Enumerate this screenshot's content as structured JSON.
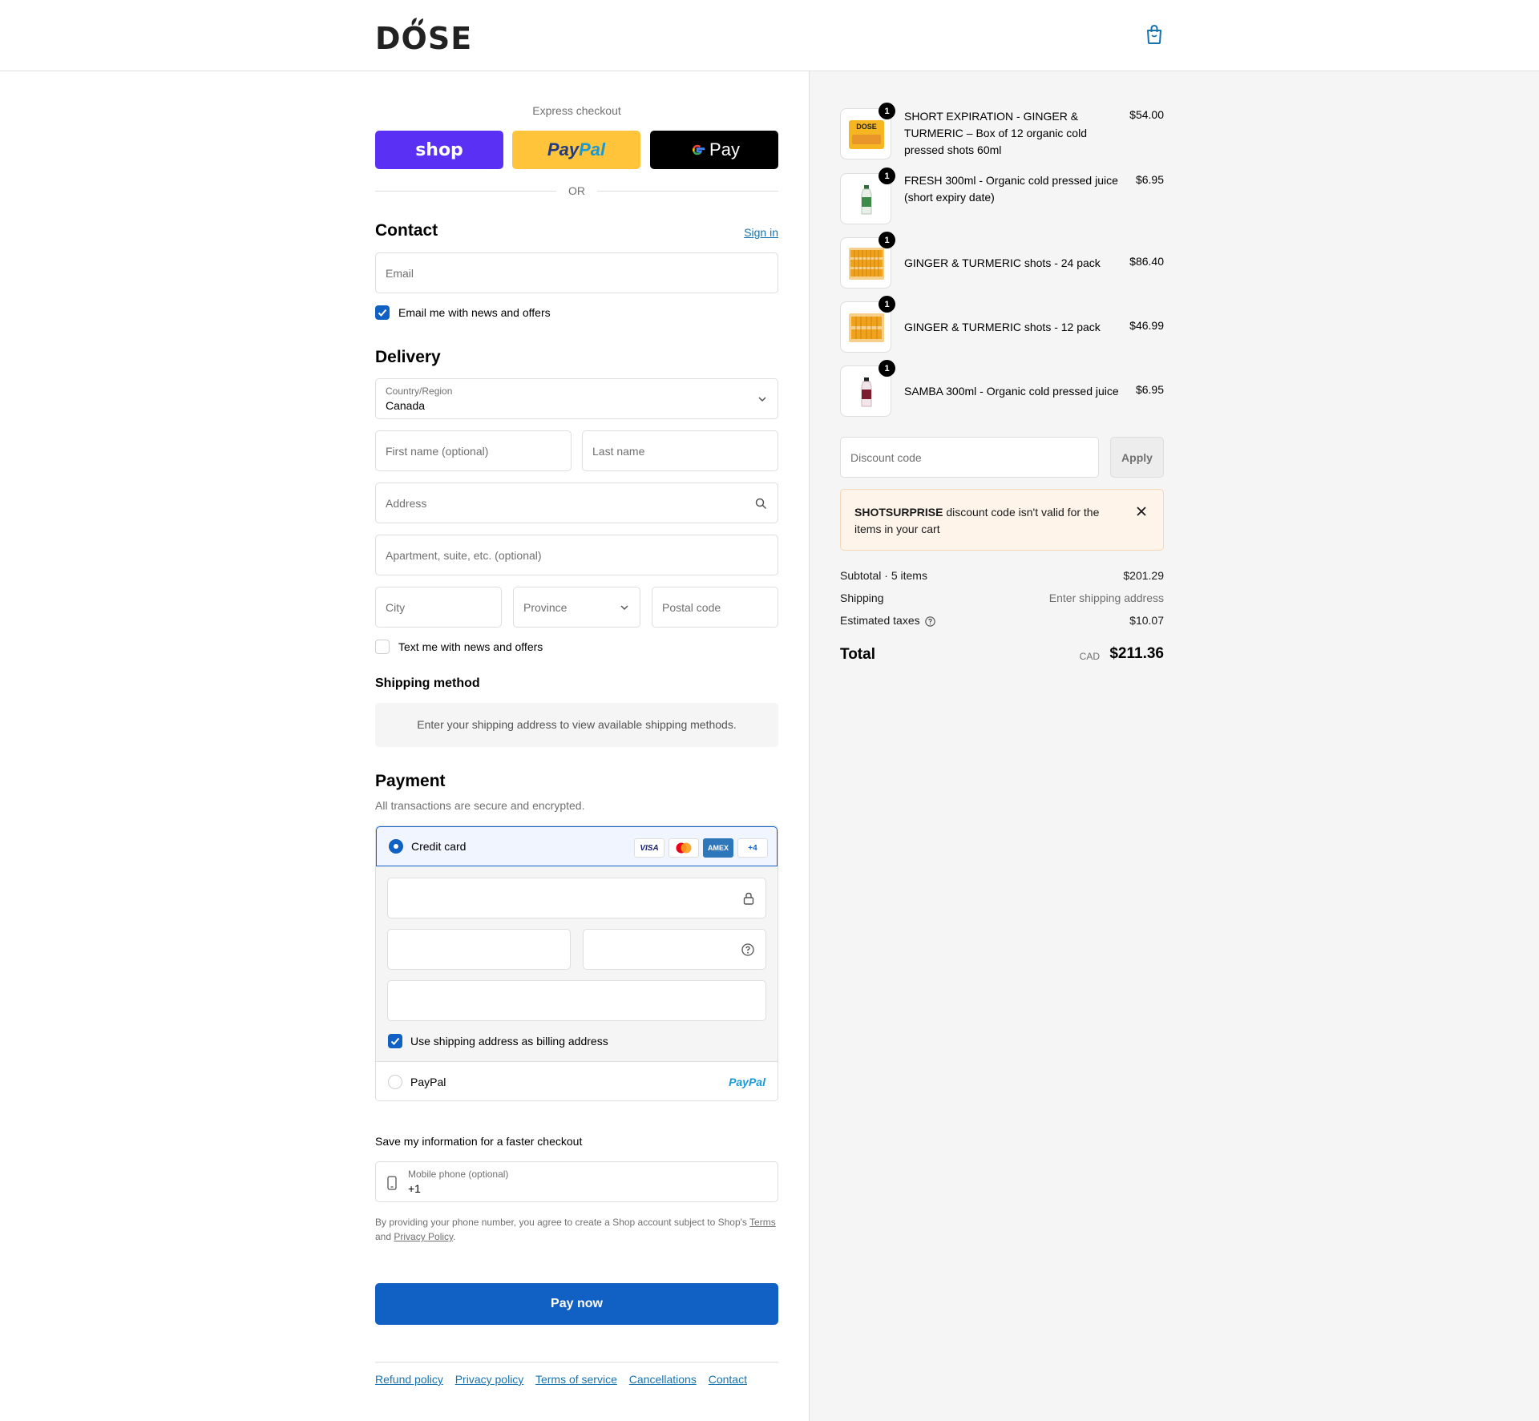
{
  "brand": {
    "logo_text": "DOSE"
  },
  "express": {
    "title": "Express checkout",
    "shop_label": "shop",
    "paypal_label": "PayPal",
    "gpay_label": "Pay",
    "or_label": "OR"
  },
  "contact": {
    "title": "Contact",
    "sign_in": "Sign in",
    "email_placeholder": "Email",
    "news_label": "Email me with news and offers"
  },
  "delivery": {
    "title": "Delivery",
    "country_label": "Country/Region",
    "country_value": "Canada",
    "first_name_placeholder": "First name (optional)",
    "last_name_placeholder": "Last name",
    "address_placeholder": "Address",
    "apartment_placeholder": "Apartment, suite, etc. (optional)",
    "city_placeholder": "City",
    "province_placeholder": "Province",
    "postal_placeholder": "Postal code",
    "text_news_label": "Text me with news and offers"
  },
  "shipping_method": {
    "title": "Shipping method",
    "info": "Enter your shipping address to view available shipping methods."
  },
  "payment": {
    "title": "Payment",
    "subtitle": "All transactions are secure and encrypted.",
    "credit_card_label": "Credit card",
    "card_badges": [
      "VISA",
      "",
      "AMEX",
      "+4"
    ],
    "billing_label": "Use shipping address as billing address",
    "paypal_label": "PayPal",
    "paypal_logo": "PayPal"
  },
  "save_info": {
    "title": "Save my information for a faster checkout",
    "phone_label": "Mobile phone (optional)",
    "phone_value": "+1",
    "disclaimer_pre": "By providing your phone number, you agree to create a Shop account subject to Shop's",
    "terms_link": "Terms",
    "disclaimer_and": "and",
    "privacy_link": "Privacy Policy",
    "disclaimer_end": "."
  },
  "pay_now": "Pay now",
  "footer": {
    "links": [
      "Refund policy",
      "Privacy policy",
      "Terms of service",
      "Cancellations",
      "Contact"
    ]
  },
  "cart": {
    "items": [
      {
        "name": "SHORT EXPIRATION - GINGER & TURMERIC – Box of 12 organic cold pressed shots 60ml",
        "price": "$54.00",
        "qty": "1",
        "thumb_text": "DOSE"
      },
      {
        "name": "FRESH 300ml - Organic cold pressed juice (short expiry date)",
        "price": "$6.95",
        "qty": "1"
      },
      {
        "name": "GINGER & TURMERIC shots - 24 pack",
        "price": "$86.40",
        "qty": "1"
      },
      {
        "name": "GINGER & TURMERIC shots - 12 pack",
        "price": "$46.99",
        "qty": "1"
      },
      {
        "name": "SAMBA 300ml - Organic cold pressed juice",
        "price": "$6.95",
        "qty": "1"
      }
    ],
    "discount_placeholder": "Discount code",
    "apply_label": "Apply",
    "warning_code": "SHOTSURPRISE",
    "warning_text": "discount code isn't valid for the items in your cart",
    "subtotal_label": "Subtotal · 5 items",
    "subtotal_value": "$201.29",
    "shipping_label": "Shipping",
    "shipping_value": "Enter shipping address",
    "taxes_label": "Estimated taxes",
    "taxes_value": "$10.07",
    "total_label": "Total",
    "currency": "CAD",
    "total_value": "$211.36"
  },
  "colors": {
    "accent": "#1160c4",
    "shop_purple": "#5a31f4",
    "paypal_yellow": "#ffc439",
    "link": "#1773b0",
    "warning_bg": "#fff4ea"
  }
}
